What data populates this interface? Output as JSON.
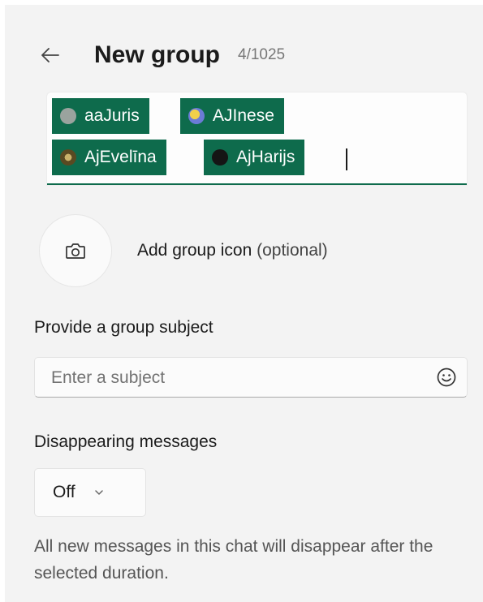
{
  "header": {
    "back_icon": "arrow-left-icon",
    "title": "New group",
    "member_count": "4/1025"
  },
  "members": [
    {
      "name": "aaJuris",
      "avatar_color": "#9aa39e"
    },
    {
      "name": "AJInese",
      "avatar_color": "#6b7bd6"
    },
    {
      "name": "AjEvelīna",
      "avatar_color": "#7d6a38"
    },
    {
      "name": "AjHarijs",
      "avatar_color": "#151515"
    }
  ],
  "group_icon": {
    "icon": "camera-icon",
    "label": "Add group icon",
    "optional": "(optional)"
  },
  "subject": {
    "label": "Provide a group subject",
    "placeholder": "Enter a subject",
    "value": "",
    "emoji_icon": "smiley-icon"
  },
  "disappearing": {
    "label": "Disappearing messages",
    "selected": "Off",
    "help": "All new messages in this chat will disappear after the selected duration."
  },
  "colors": {
    "accent": "#0e6b4c",
    "panel_bg": "#f3f3f3"
  }
}
